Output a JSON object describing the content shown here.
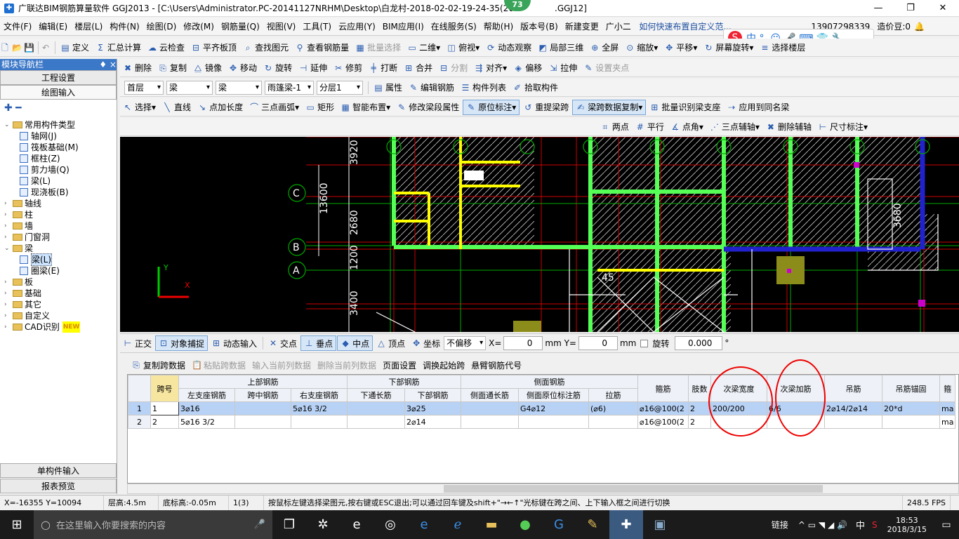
{
  "window": {
    "title": "广联达BIM钢筋算量软件 GGJ2013 - [C:\\Users\\Administrator.PC-20141127NRHM\\Desktop\\白龙村-2018-02-02-19-24-35(20",
    "title_suffix": ".GGJ12]",
    "badge": "73",
    "min": "—",
    "max": "❐",
    "close": "✕"
  },
  "menu": [
    "文件(F)",
    "编辑(E)",
    "楼层(L)",
    "构件(N)",
    "绘图(D)",
    "修改(M)",
    "钢筋量(Q)",
    "视图(V)",
    "工具(T)",
    "云应用(Y)",
    "BIM应用(I)",
    "在线服务(S)",
    "帮助(H)",
    "版本号(B)",
    "新建变更",
    "广小二"
  ],
  "menu_right": {
    "hint": "如何快速布置自定义范...",
    "phone": "13907298339",
    "price": "造价豆:0"
  },
  "toolbar1": [
    "定义",
    "汇总计算",
    "云检查",
    "平齐板顶",
    "查找图元",
    "查看钢筋量",
    "批量选择",
    "二维",
    "俯视",
    "动态观察",
    "局部三维",
    "全屏",
    "缩放",
    "平移",
    "屏幕旋转",
    "选择楼层"
  ],
  "toolbar2": [
    "删除",
    "复制",
    "镜像",
    "移动",
    "旋转",
    "延伸",
    "修剪",
    "打断",
    "合并",
    "分割",
    "对齐",
    "偏移",
    "拉伸",
    "设置夹点"
  ],
  "toolbar3": {
    "floor": "首层",
    "type1": "梁",
    "type2": "梁",
    "name": "雨篷梁-1",
    "layer": "分层1",
    "buttons": [
      "属性",
      "编辑钢筋",
      "构件列表",
      "拾取构件"
    ]
  },
  "toolbar4": [
    "选择",
    "直线",
    "点加长度",
    "三点画弧",
    "矩形",
    "智能布置",
    "修改梁段属性",
    "原位标注",
    "重提梁跨",
    "梁跨数据复制",
    "批量识别梁支座",
    "应用到同名梁"
  ],
  "toolbar5": [
    "两点",
    "平行",
    "点角",
    "三点辅轴",
    "删除辅轴",
    "尺寸标注"
  ],
  "leftpanel": {
    "header": "模块导航栏",
    "pin": "♦ ×",
    "btn1": "工程设置",
    "btn2": "绘图输入",
    "btn3": "单构件输入",
    "btn4": "报表预览",
    "tree": [
      {
        "label": "常用构件类型",
        "level": 0,
        "type": "folder",
        "open": true
      },
      {
        "label": "轴网(J)",
        "level": 1,
        "type": "leaf"
      },
      {
        "label": "筏板基础(M)",
        "level": 1,
        "type": "leaf"
      },
      {
        "label": "框柱(Z)",
        "level": 1,
        "type": "leaf"
      },
      {
        "label": "剪力墙(Q)",
        "level": 1,
        "type": "leaf"
      },
      {
        "label": "梁(L)",
        "level": 1,
        "type": "leaf"
      },
      {
        "label": "现浇板(B)",
        "level": 1,
        "type": "leaf"
      },
      {
        "label": "轴线",
        "level": 0,
        "type": "folder"
      },
      {
        "label": "柱",
        "level": 0,
        "type": "folder"
      },
      {
        "label": "墙",
        "level": 0,
        "type": "folder"
      },
      {
        "label": "门窗洞",
        "level": 0,
        "type": "folder"
      },
      {
        "label": "梁",
        "level": 0,
        "type": "folder",
        "open": true
      },
      {
        "label": "梁(L)",
        "level": 1,
        "type": "leaf",
        "selected": true
      },
      {
        "label": "圈梁(E)",
        "level": 1,
        "type": "leaf"
      },
      {
        "label": "板",
        "level": 0,
        "type": "folder"
      },
      {
        "label": "基础",
        "level": 0,
        "type": "folder"
      },
      {
        "label": "其它",
        "level": 0,
        "type": "folder"
      },
      {
        "label": "自定义",
        "level": 0,
        "type": "folder"
      },
      {
        "label": "CAD识别",
        "level": 0,
        "type": "folder",
        "new": "NEW"
      }
    ]
  },
  "canvas": {
    "axis_labels": [
      "C",
      "B",
      "A"
    ],
    "dims": [
      "3920",
      "13600",
      "2680",
      "1200",
      "3400",
      "3680",
      "45"
    ],
    "y_label": "Y",
    "x_label": "X"
  },
  "snapbar": {
    "items": [
      "正交",
      "对象捕捉",
      "动态输入",
      "交点",
      "垂点",
      "中点",
      "顶点",
      "坐标"
    ],
    "offset": "不偏移",
    "x_label": "X=",
    "x_val": "0",
    "y_label": "mm Y=",
    "y_val": "0",
    "mm": "mm",
    "rotate": "旋转",
    "rotate_val": "0.000",
    "deg": "°"
  },
  "tabletools": [
    "复制跨数据",
    "粘贴跨数据",
    "输入当前列数据",
    "删除当前列数据",
    "页面设置",
    "调换起始跨",
    "悬臂钢筋代号"
  ],
  "grid": {
    "group_headers": {
      "top": "上部钢筋",
      "bottom": "下部钢筋",
      "side": "侧面钢筋"
    },
    "headers": [
      "跨号",
      "左支座钢筋",
      "跨中钢筋",
      "右支座钢筋",
      "下通长筋",
      "下部钢筋",
      "侧面通长筋",
      "侧面原位标注筋",
      "拉筋",
      "箍筋",
      "肢数",
      "次梁宽度",
      "次梁加筋",
      "吊筋",
      "吊筋锚固",
      "箍"
    ],
    "rows": [
      {
        "n": "1",
        "cells": [
          "1",
          "3⌀16",
          "",
          "5⌀16 3/2",
          "",
          "3⌀25",
          "",
          "G4⌀12",
          "(⌀6)",
          "⌀16@100(2",
          "2",
          "200/200",
          "6/6",
          "2⌀14/2⌀14",
          "20*d",
          "ma"
        ]
      },
      {
        "n": "2",
        "cells": [
          "2",
          "5⌀16 3/2",
          "",
          "",
          "",
          "2⌀14",
          "",
          "",
          "",
          "⌀16@100(2",
          "2",
          "",
          "",
          "",
          "",
          "ma"
        ]
      }
    ]
  },
  "status": {
    "coords": "X=-16355 Y=10094",
    "floor_h": "层高:4.5m",
    "base_h": "底标高:-0.05m",
    "count": "1(3)",
    "hint": "按鼠标左键选择梁图元,按右键或ESC退出;可以通过回车键及shift+\"→←↑\"光标键在跨之间、上下输入框之间进行切换",
    "fps": "248.5 FPS"
  },
  "taskbar": {
    "search": "在这里输入你要搜索的内容",
    "link": "链接",
    "ime": "中",
    "time": "18:53",
    "date": "2018/3/15"
  }
}
